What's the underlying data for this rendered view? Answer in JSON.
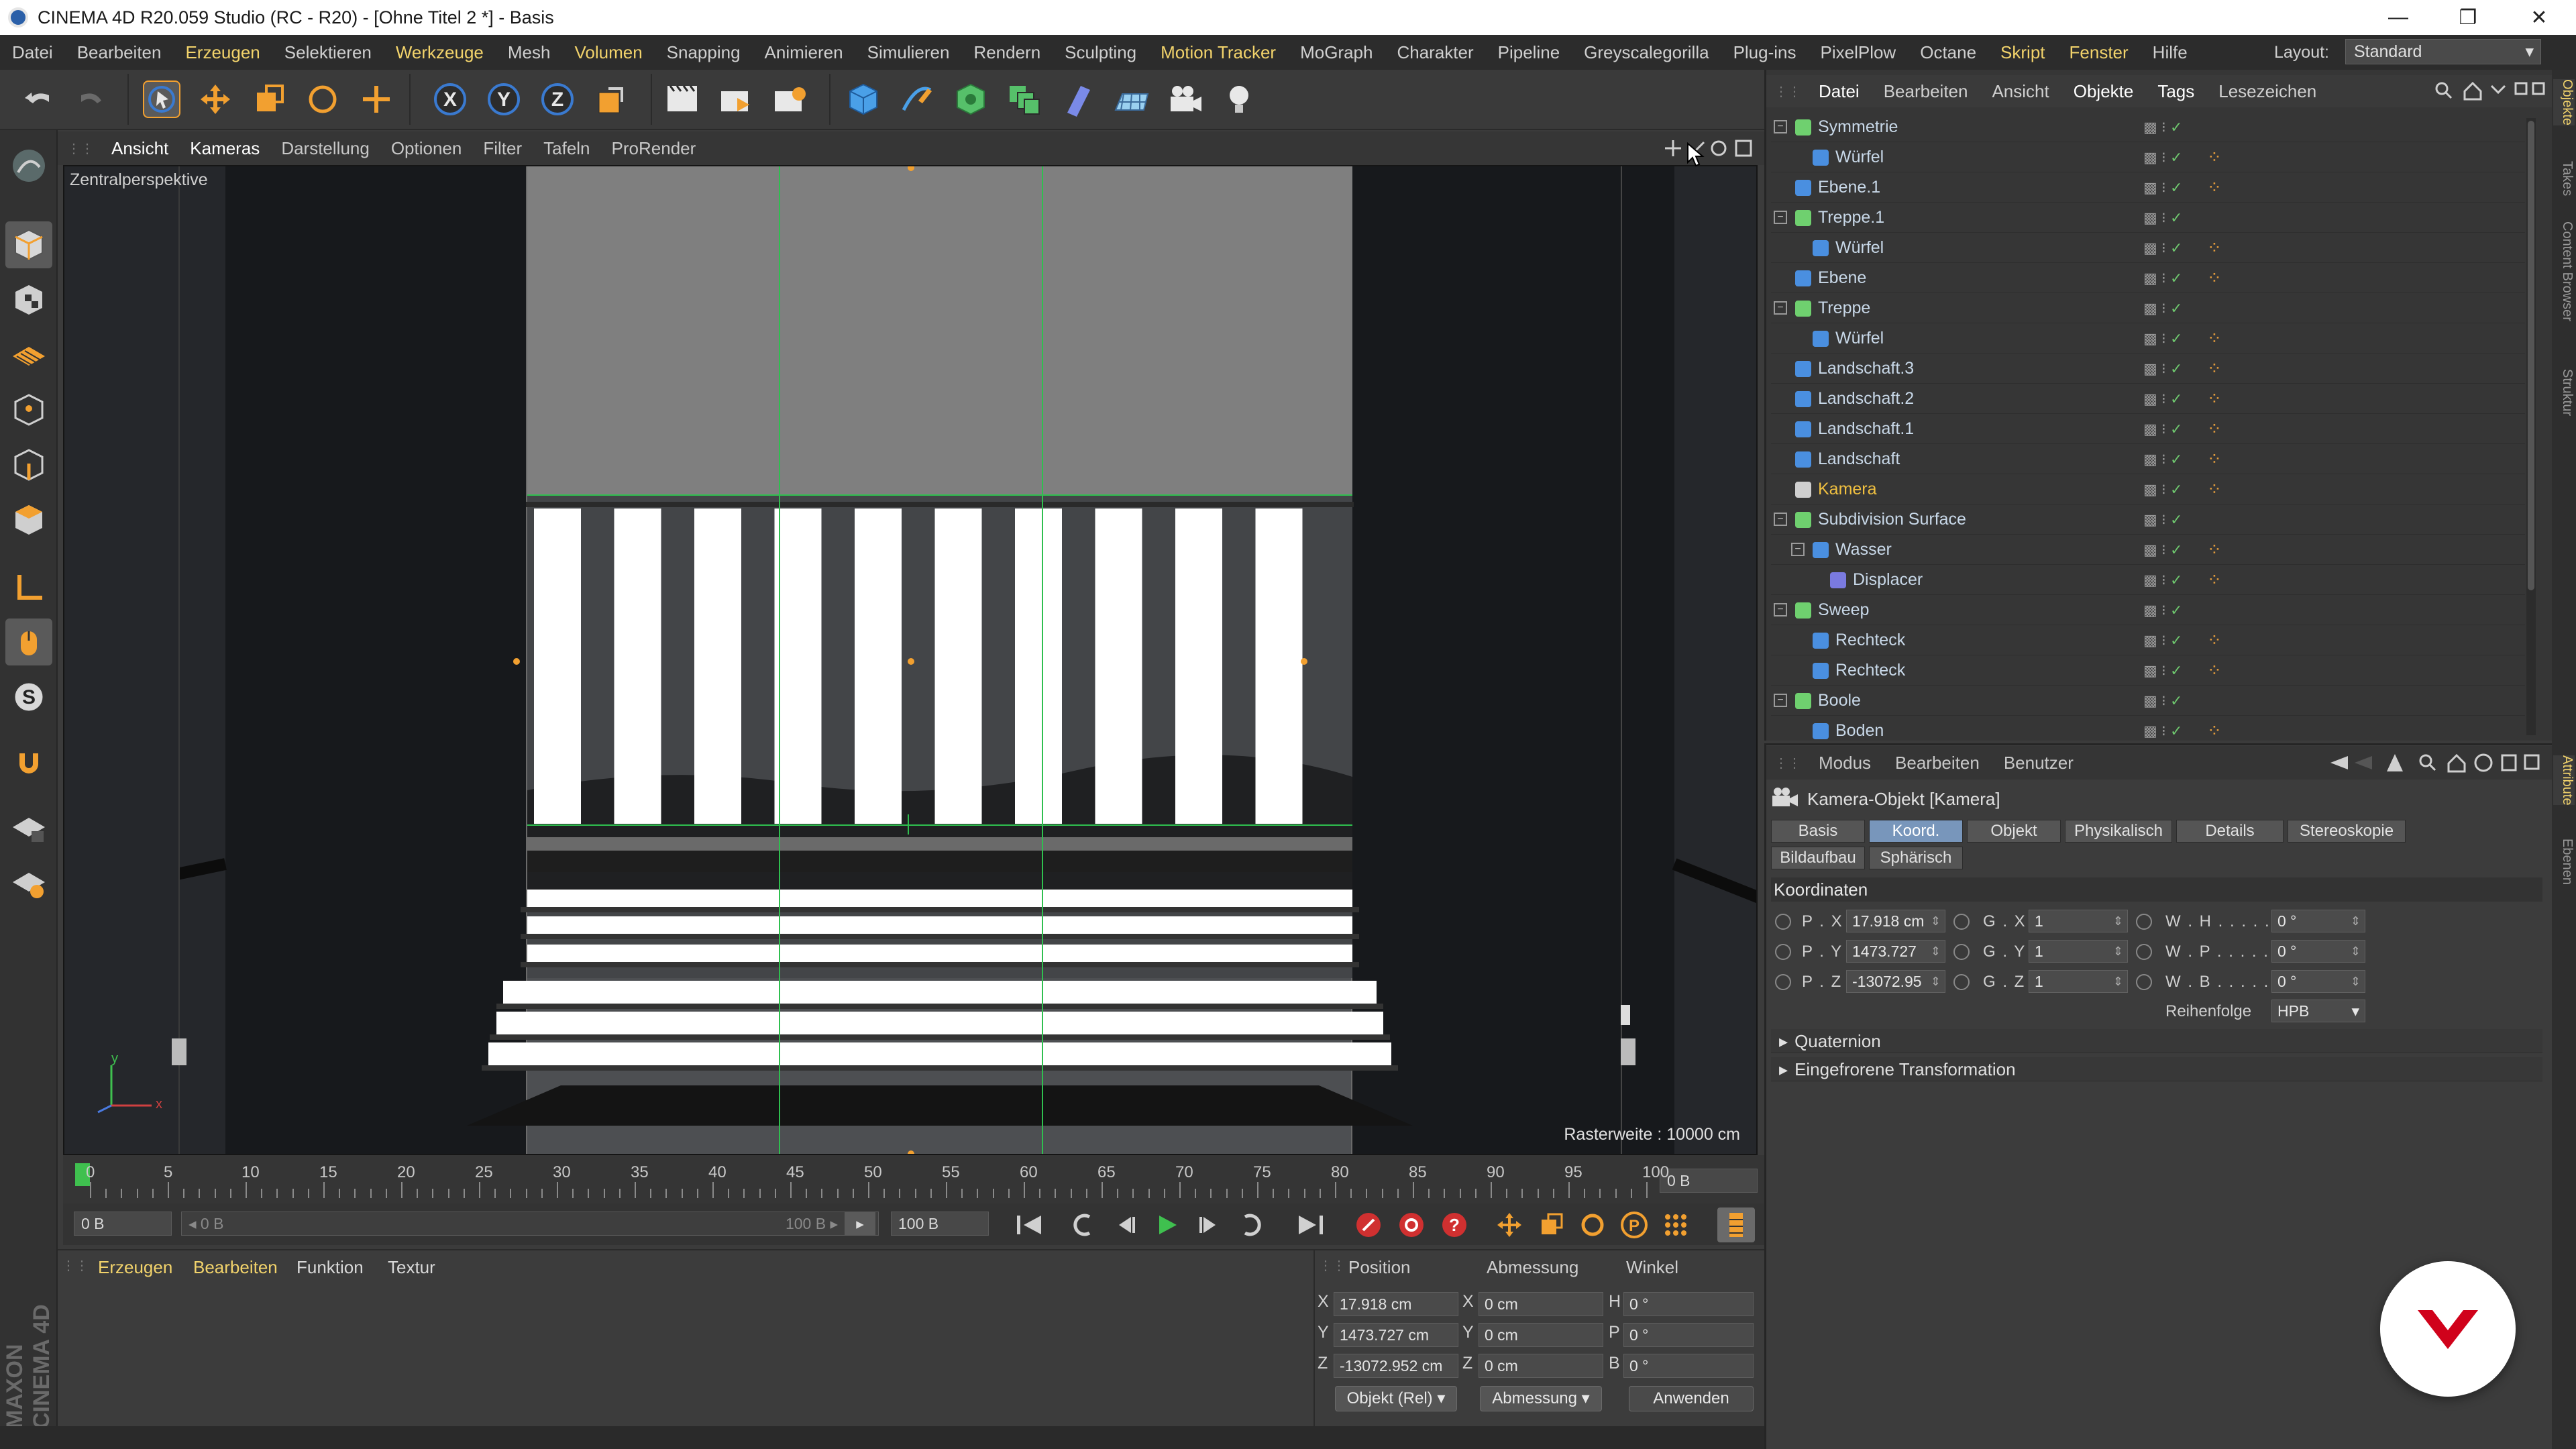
{
  "window": {
    "title": "CINEMA 4D R20.059 Studio (RC - R20) - [Ohne Titel 2 *] - Basis",
    "minimize": "—",
    "maximize": "❐",
    "close": "✕"
  },
  "menubar": {
    "items": [
      "Datei",
      "Bearbeiten",
      "Erzeugen",
      "Selektieren",
      "Werkzeuge",
      "Mesh",
      "Volumen",
      "Snapping",
      "Animieren",
      "Simulieren",
      "Rendern",
      "Sculpting",
      "Motion Tracker",
      "MoGraph",
      "Charakter",
      "Pipeline",
      "Greyscalegorilla",
      "Plug-ins",
      "PixelPlow",
      "Octane",
      "Skript",
      "Fenster",
      "Hilfe"
    ],
    "layout_label": "Layout:",
    "layout_value": "Standard"
  },
  "viewport": {
    "menu": [
      "Ansicht",
      "Kameras",
      "Darstellung",
      "Optionen",
      "Filter",
      "Tafeln",
      "ProRender"
    ],
    "camera_label": "Zentralperspektive",
    "raster": "Rasterweite : 10000 cm"
  },
  "timeline": {
    "ticks": [
      "0",
      "5",
      "10",
      "15",
      "20",
      "25",
      "30",
      "35",
      "40",
      "45",
      "50",
      "55",
      "60",
      "65",
      "70",
      "75",
      "80",
      "85",
      "90",
      "95",
      "100"
    ],
    "current_frame": "0 B",
    "start": "0 B",
    "range_start": "◂ 0 B",
    "range_end": "100 B ▸",
    "end": "100 B"
  },
  "material_panel": {
    "menu": [
      "Erzeugen",
      "Bearbeiten",
      "Funktion",
      "Textur"
    ]
  },
  "coord_panel": {
    "headers": [
      "Position",
      "Abmessung",
      "Winkel"
    ],
    "rows": [
      {
        "axis": "X",
        "pos": "17.918 cm",
        "size_axis": "X",
        "size": "0 cm",
        "rot_axis": "H",
        "rot": "0 °"
      },
      {
        "axis": "Y",
        "pos": "1473.727 cm",
        "size_axis": "Y",
        "size": "0 cm",
        "rot_axis": "P",
        "rot": "0 °"
      },
      {
        "axis": "Z",
        "pos": "-13072.952 cm",
        "size_axis": "Z",
        "size": "0 cm",
        "rot_axis": "B",
        "rot": "0 °"
      }
    ],
    "mode_button": "Objekt (Rel) ▾",
    "size_button": "Abmessung ▾",
    "apply_button": "Anwenden"
  },
  "object_manager": {
    "menu": [
      "Datei",
      "Bearbeiten",
      "Ansicht",
      "Objekte",
      "Tags",
      "Lesezeichen"
    ],
    "objects": [
      {
        "name": "Symmetrie",
        "level": 0,
        "expand": "⊟",
        "color": "#6fd06f",
        "selected": false
      },
      {
        "name": "Würfel",
        "level": 1,
        "expand": "",
        "color": "#4a8fe0",
        "selected": false
      },
      {
        "name": "Ebene.1",
        "level": 0,
        "expand": "",
        "color": "#4a8fe0",
        "selected": false
      },
      {
        "name": "Treppe.1",
        "level": 0,
        "expand": "⊟",
        "color": "#6fd06f",
        "selected": false
      },
      {
        "name": "Würfel",
        "level": 1,
        "expand": "",
        "color": "#4a8fe0",
        "selected": false
      },
      {
        "name": "Ebene",
        "level": 0,
        "expand": "",
        "color": "#4a8fe0",
        "selected": false
      },
      {
        "name": "Treppe",
        "level": 0,
        "expand": "⊟",
        "color": "#6fd06f",
        "selected": false
      },
      {
        "name": "Würfel",
        "level": 1,
        "expand": "",
        "color": "#4a8fe0",
        "selected": false
      },
      {
        "name": "Landschaft.3",
        "level": 0,
        "expand": "",
        "color": "#4a8fe0",
        "selected": false
      },
      {
        "name": "Landschaft.2",
        "level": 0,
        "expand": "",
        "color": "#4a8fe0",
        "selected": false
      },
      {
        "name": "Landschaft.1",
        "level": 0,
        "expand": "",
        "color": "#4a8fe0",
        "selected": false
      },
      {
        "name": "Landschaft",
        "level": 0,
        "expand": "",
        "color": "#4a8fe0",
        "selected": false
      },
      {
        "name": "Kamera",
        "level": 0,
        "expand": "",
        "color": "#cfcfcf",
        "selected": true
      },
      {
        "name": "Subdivision Surface",
        "level": 0,
        "expand": "⊟",
        "color": "#6fd06f",
        "selected": false
      },
      {
        "name": "Wasser",
        "level": 1,
        "expand": "⊟",
        "color": "#4a8fe0",
        "selected": false
      },
      {
        "name": "Displacer",
        "level": 2,
        "expand": "",
        "color": "#7a7ae0",
        "selected": false
      },
      {
        "name": "Sweep",
        "level": 0,
        "expand": "⊟",
        "color": "#6fd06f",
        "selected": false
      },
      {
        "name": "Rechteck",
        "level": 1,
        "expand": "",
        "color": "#4a8fe0",
        "selected": false
      },
      {
        "name": "Rechteck",
        "level": 1,
        "expand": "",
        "color": "#4a8fe0",
        "selected": false
      },
      {
        "name": "Boole",
        "level": 0,
        "expand": "⊟",
        "color": "#6fd06f",
        "selected": false
      },
      {
        "name": "Boden",
        "level": 1,
        "expand": "",
        "color": "#4a8fe0",
        "selected": false
      }
    ]
  },
  "attribute_manager": {
    "menu": [
      "Modus",
      "Bearbeiten",
      "Benutzer"
    ],
    "title": "Kamera-Objekt [Kamera]",
    "tabs_row1": [
      "Basis",
      "Koord.",
      "Objekt",
      "Physikalisch",
      "Details",
      "Stereoskopie"
    ],
    "tabs_row2": [
      "Bildaufbau",
      "Sphärisch"
    ],
    "active_tab": "Koord.",
    "section": "Koordinaten",
    "rows": [
      {
        "p_lbl": "P . X",
        "p": "17.918 cm",
        "g_lbl": "G . X",
        "g": "1",
        "w_lbl": "W . H . . . . . .",
        "w": "0 °"
      },
      {
        "p_lbl": "P . Y",
        "p": "1473.727",
        "g_lbl": "G . Y",
        "g": "1",
        "w_lbl": "W . P . . . . . .",
        "w": "0 °"
      },
      {
        "p_lbl": "P . Z",
        "p": "-13072.95",
        "g_lbl": "G . Z",
        "g": "1",
        "w_lbl": "W . B . . . . . .",
        "w": "0 °"
      }
    ],
    "order_label": "Reihenfolge",
    "order_value": "HPB",
    "folds": [
      "Quaternion",
      "Eingefrorene Transformation"
    ]
  },
  "side_tabs": [
    "Objekte",
    "Takes",
    "Content Browser",
    "Struktur",
    "Attribute",
    "Ebenen"
  ],
  "colors": {
    "accent": "#f2d36b",
    "active_tab": "#7896bb",
    "selected_object": "#f0c040",
    "fab_logo": "#d0021b"
  }
}
